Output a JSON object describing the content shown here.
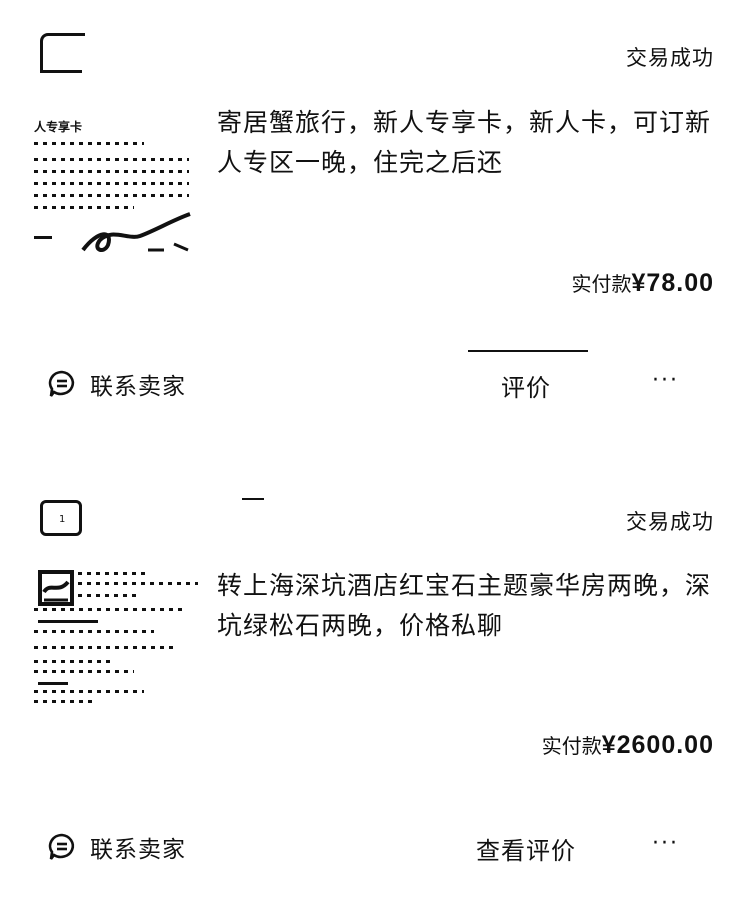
{
  "orders": [
    {
      "status": "交易成功",
      "title": "寄居蟹旅行，新人专享卡，新人卡，可订新人专区一晚，住完之后还",
      "thumb_head": "人专享卡",
      "price_label": "实付款",
      "price_value": "¥78.00",
      "contact_label": "联系卖家",
      "action_label": "评价",
      "more_label": "···"
    },
    {
      "status": "交易成功",
      "title": "转上海深坑酒店红宝石主题豪华房两晚，深坑绿松石两晚，价格私聊",
      "price_label": "实付款",
      "price_value": "¥2600.00",
      "contact_label": "联系卖家",
      "action_label": "查看评价",
      "more_label": "···"
    }
  ],
  "icons": {
    "shop": "shop-icon",
    "chat": "chat-bubble-icon",
    "more": "more-icon"
  }
}
